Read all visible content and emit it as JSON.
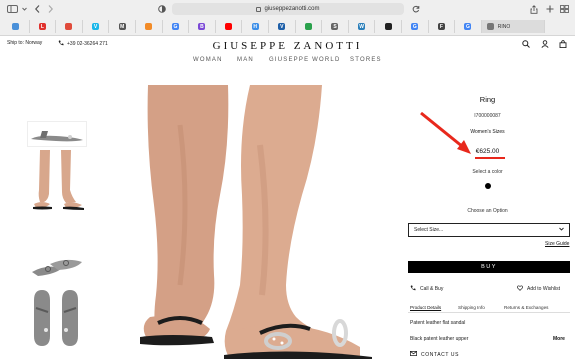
{
  "browser": {
    "url": "giuseppezanotti.com",
    "tabs": [
      {
        "icon": "generic-tab-icon",
        "color": "#4a90d9",
        "glyph": "",
        "active": false
      },
      {
        "icon": "tab-favicon-l",
        "color": "#e0312c",
        "glyph": "L",
        "active": false
      },
      {
        "icon": "tab-favicon-calendar",
        "color": "#e04b3b",
        "glyph": "",
        "active": false
      },
      {
        "icon": "tab-favicon-vimeo",
        "color": "#1ab7ea",
        "glyph": "V",
        "active": false
      },
      {
        "icon": "tab-favicon-m",
        "color": "#555555",
        "glyph": "M",
        "active": false
      },
      {
        "icon": "tab-favicon-orange",
        "color": "#f28b27",
        "glyph": "",
        "active": false
      },
      {
        "icon": "tab-favicon-google",
        "color": "#4285f4",
        "glyph": "G",
        "active": false
      },
      {
        "icon": "tab-favicon-b",
        "color": "#7b49d6",
        "glyph": "B",
        "active": false
      },
      {
        "icon": "tab-favicon-youtube",
        "color": "#ff0000",
        "glyph": "",
        "active": false
      },
      {
        "icon": "tab-favicon-hd",
        "color": "#3b8ee8",
        "glyph": "H",
        "active": false
      },
      {
        "icon": "tab-favicon-v",
        "color": "#1e5fa8",
        "glyph": "V",
        "active": false
      },
      {
        "icon": "tab-favicon-green",
        "color": "#2aa14c",
        "glyph": "",
        "active": false
      },
      {
        "icon": "tab-favicon-s",
        "color": "#666666",
        "glyph": "S",
        "active": false
      },
      {
        "icon": "tab-favicon-wordpress",
        "color": "#2a7fba",
        "glyph": "W",
        "active": false
      },
      {
        "icon": "tab-favicon-disc",
        "color": "#222222",
        "glyph": "",
        "active": false
      },
      {
        "icon": "tab-favicon-google",
        "color": "#4285f4",
        "glyph": "G",
        "active": false
      },
      {
        "icon": "tab-favicon-fp",
        "color": "#444444",
        "glyph": "F",
        "active": false
      },
      {
        "icon": "tab-favicon-google",
        "color": "#4285f4",
        "glyph": "G",
        "active": false
      },
      {
        "icon": "tab-favicon-rino",
        "color": "#777777",
        "glyph": "",
        "active": true,
        "title": "RINO"
      }
    ]
  },
  "header": {
    "ship_to": "Ship to: Norway",
    "phone": "+39 02-36264 271",
    "logo": "GIUSEPPE ZANOTTI",
    "nav": [
      "WOMAN",
      "MAN",
      "GIUSEPPE WORLD",
      "STORES"
    ]
  },
  "product": {
    "title": "Ring",
    "sku": "I700000087",
    "sizes_label": "Women's Sizes",
    "price": "€625.00",
    "color_label": "Select a color",
    "option_label": "Choose an Option",
    "select_placeholder": "Select Size...",
    "size_guide": "Size Guide",
    "buy_label": "BUY",
    "call_buy": "Call & Buy",
    "wishlist": "Add to Wishlist",
    "tabs": [
      "Product Details",
      "Shipping Info",
      "Returns & Exchanges"
    ],
    "description": [
      "Patent leather flat sandal",
      "Black patent leather upper"
    ],
    "more": "More",
    "contact": "CONTACT US"
  },
  "colors": {
    "accent_red": "#e8281c",
    "button_black": "#000000",
    "skin": "#d8a78c",
    "sandal": "#222222"
  }
}
